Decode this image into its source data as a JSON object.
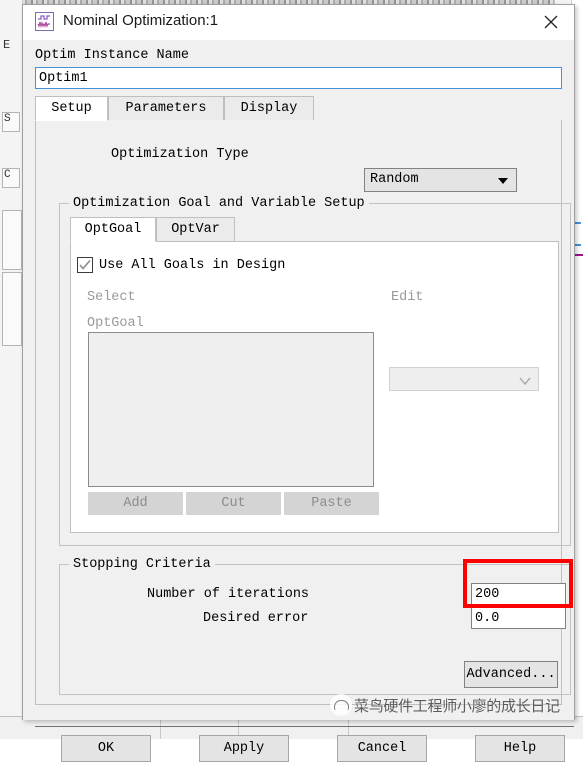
{
  "window": {
    "title": "Nominal Optimization:1",
    "icon": "optimization-waveform-icon",
    "close_icon": "close-icon"
  },
  "instance": {
    "label": "Optim Instance Name",
    "value": "Optim1",
    "placeholder": ""
  },
  "outer_tabs": [
    {
      "label": "Setup",
      "active": true
    },
    {
      "label": "Parameters",
      "active": false
    },
    {
      "label": "Display",
      "active": false
    }
  ],
  "optimization_type": {
    "label": "Optimization Type",
    "selected": "Random",
    "arrow_icon": "chevron-down-icon"
  },
  "goal_group": {
    "title": "Optimization Goal and Variable Setup",
    "inner_tabs": [
      {
        "label": "OptGoal",
        "active": true
      },
      {
        "label": "OptVar",
        "active": false
      }
    ],
    "use_all_goals": {
      "label": "Use All Goals in Design",
      "checked": true,
      "check_icon": "check-icon"
    },
    "select_label": "Select",
    "edit_label": "Edit",
    "optgoal_caption": "OptGoal",
    "list_items": [],
    "edit_combo_value": "",
    "edit_combo_arrow_icon": "chevron-down-icon",
    "buttons": [
      {
        "label": "Add"
      },
      {
        "label": "Cut"
      },
      {
        "label": "Paste"
      }
    ]
  },
  "stopping_criteria": {
    "title": "Stopping Criteria",
    "iterations_label": "Number of iterations",
    "iterations_value": "200",
    "error_label": "Desired error",
    "error_value": "0.0",
    "advanced_label": "Advanced...",
    "highlight_color": "#ff0000"
  },
  "footer_buttons": [
    {
      "label": "OK"
    },
    {
      "label": "Apply"
    },
    {
      "label": "Cancel"
    },
    {
      "label": "Help"
    }
  ],
  "watermark": {
    "text": "菜鸟硬件工程师小廖的成长日记",
    "logo_icon": "wechat-cloud-logo-icon"
  },
  "background": {
    "toolbar_letter": "E",
    "side_letter_1": "S",
    "side_letter_2": "C"
  }
}
